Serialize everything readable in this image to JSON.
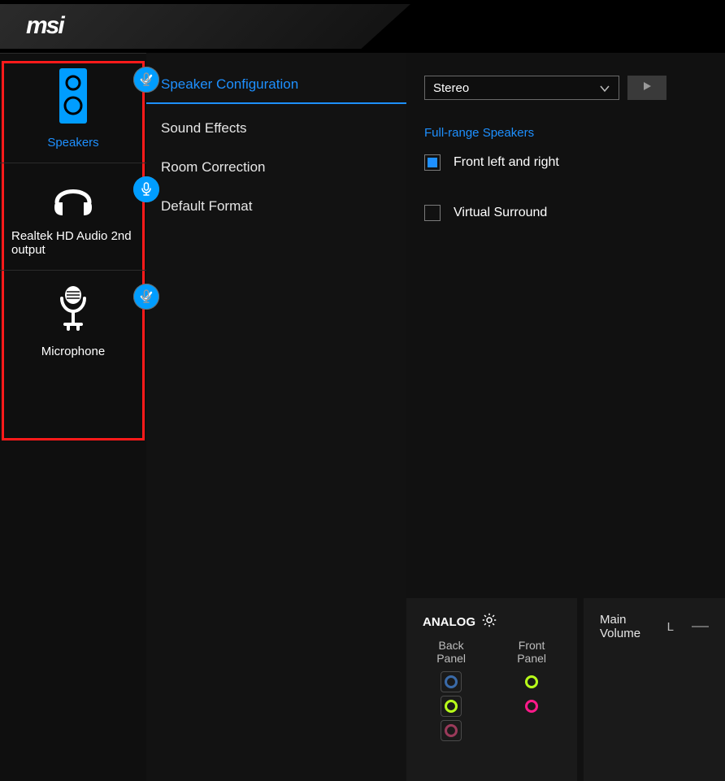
{
  "header": {
    "brand": "msi"
  },
  "sidebar": {
    "devices": [
      {
        "label": "Speakers",
        "active": true,
        "default_device": true,
        "default_comm": false
      },
      {
        "label": "Realtek HD Audio 2nd output",
        "active": false,
        "default_device": false,
        "default_comm": true
      },
      {
        "label": "Microphone",
        "active": false,
        "default_device": true,
        "default_comm": false
      }
    ]
  },
  "tabs": [
    "Speaker Configuration",
    "Sound Effects",
    "Room Correction",
    "Default Format"
  ],
  "content": {
    "config_select": {
      "value": "Stereo"
    },
    "full_range": {
      "title": "Full-range Speakers",
      "front_lr": "Front left and right",
      "front_lr_checked": true
    },
    "virtual_surround": "Virtual Surround",
    "virtual_surround_checked": false
  },
  "bottom": {
    "analog": {
      "title": "ANALOG",
      "back_panel": "Back Panel",
      "front_panel": "Front Panel",
      "back_jacks": [
        {
          "color": "#3a6aa8",
          "style": "color:#3a6aa8"
        },
        {
          "color": "#b8ff1a",
          "style": "color:#b8ff1a"
        },
        {
          "color": "#9a3a5a",
          "style": "color:#9a3a5a"
        }
      ],
      "front_jacks": [
        {
          "color": "#b8ff1a",
          "style": "color:#b8ff1a"
        },
        {
          "color": "#ff1a8a",
          "style": "color:#ff1a8a"
        }
      ]
    },
    "main_volume": {
      "title": "Main Volume",
      "l_label": "L"
    }
  },
  "colors": {
    "accent": "#1e90ff",
    "brand_blue": "#009dff",
    "highlight_red": "#ff1a1a"
  }
}
